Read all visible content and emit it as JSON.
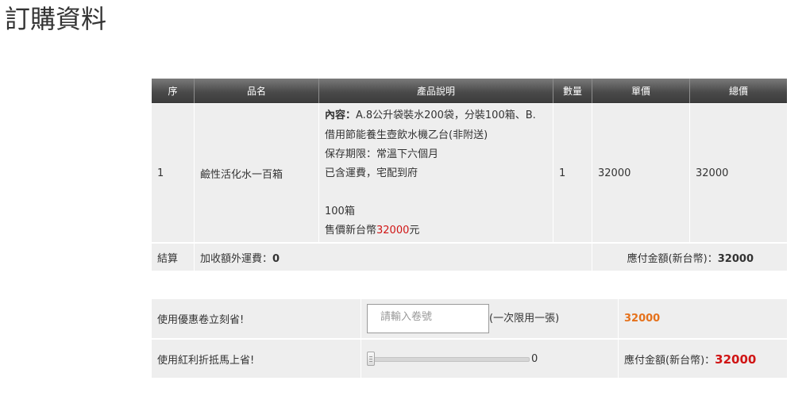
{
  "page": {
    "title": "訂購資料"
  },
  "order": {
    "headers": {
      "seq": "序",
      "name": "品名",
      "desc": "產品說明",
      "qty": "數量",
      "unit_price": "單價",
      "total": "總價"
    },
    "item": {
      "seq": "1",
      "name": "鹼性活化水一百箱",
      "desc": {
        "content_label": "內容：",
        "content_line1": "A.8公升袋裝水200袋，分裝100箱、B.",
        "content_line2": "借用節能養生壺飲水機乙台(非附送)",
        "shelf_life": "保存期限：常溫下六個月",
        "shipping_note": "已含運費，宅配到府",
        "quantity_note": "100箱",
        "price_prefix": "售價新台幣",
        "price_value": "32000",
        "price_suffix": "元"
      },
      "qty": "1",
      "unit_price": "32000",
      "total": "32000"
    },
    "summary": {
      "label": "結算",
      "shipping_label": "加收額外運費：",
      "shipping_value": "0",
      "payable_label": "應付金額(新台幣)：",
      "payable_value": "32000"
    }
  },
  "discount": {
    "coupon_label": "使用優惠卷立刻省!",
    "coupon_placeholder": "請輸入卷號",
    "coupon_note": "(一次限用一張)",
    "coupon_result": "32000",
    "bonus_label": "使用紅利折抵馬上省!",
    "bonus_slider_value": "0",
    "bonus_slider_fraction": 0,
    "payable_label": "應付金額(新台幣)：",
    "payable_value": "32000"
  },
  "colors": {
    "header_bg": "#4a4a4a",
    "cell_bg": "#eeeeee",
    "accent_red": "#d01515",
    "accent_orange": "#e5711b"
  }
}
